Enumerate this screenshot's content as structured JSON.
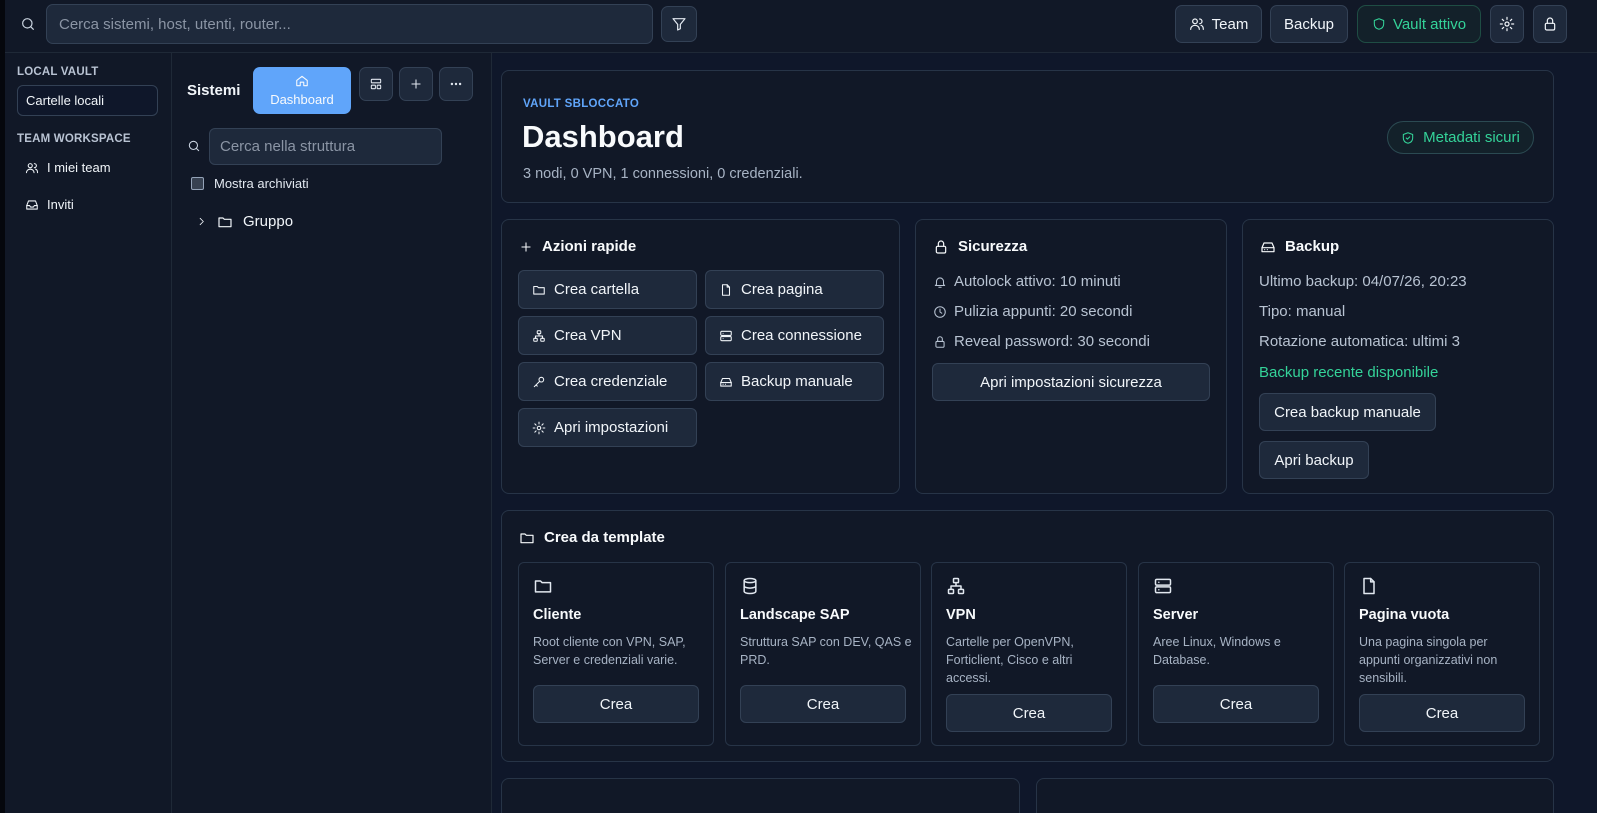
{
  "topbar": {
    "search_placeholder": "Cerca sistemi, host, utenti, router...",
    "team_label": "Team",
    "backup_label": "Backup",
    "vault_status": "Vault attivo"
  },
  "sidebar": {
    "local_heading": "LOCAL VAULT",
    "local_item": "Cartelle locali",
    "team_heading": "TEAM WORKSPACE",
    "items": [
      {
        "label": "I miei team",
        "icon": "users-icon"
      },
      {
        "label": "Inviti",
        "icon": "inbox-icon"
      }
    ]
  },
  "tree": {
    "title": "Sistemi",
    "dashboard_label": "Dashboard",
    "search_placeholder": "Cerca nella struttura",
    "archive_label": "Mostra archiviati",
    "group_label": "Gruppo"
  },
  "hero": {
    "eyebrow": "VAULT SBLOCCATO",
    "title": "Dashboard",
    "subtitle": "3 nodi, 0 VPN, 1 connessioni, 0 credenziali.",
    "badge": "Metadati sicuri"
  },
  "quick_actions": {
    "title": "Azioni rapide",
    "buttons": [
      {
        "label": "Crea cartella",
        "icon": "folder-icon"
      },
      {
        "label": "Crea pagina",
        "icon": "file-icon"
      },
      {
        "label": "Crea VPN",
        "icon": "network-icon"
      },
      {
        "label": "Crea connessione",
        "icon": "server-icon"
      },
      {
        "label": "Crea credenziale",
        "icon": "key-icon"
      },
      {
        "label": "Backup manuale",
        "icon": "drive-icon"
      },
      {
        "label": "Apri impostazioni",
        "icon": "gear-icon"
      }
    ]
  },
  "security": {
    "title": "Sicurezza",
    "lines": [
      {
        "label": "Autolock attivo: 10 minuti",
        "icon": "bell-icon"
      },
      {
        "label": "Pulizia appunti: 20 secondi",
        "icon": "clock-icon"
      },
      {
        "label": "Reveal password: 30 secondi",
        "icon": "lock-icon"
      }
    ],
    "button": "Apri impostazioni sicurezza"
  },
  "backup": {
    "title": "Backup",
    "last": "Ultimo backup: 04/07/26, 20:23",
    "type": "Tipo: manual",
    "rotation": "Rotazione automatica: ultimi 3",
    "status": "Backup recente disponibile",
    "create_btn": "Crea backup manuale",
    "open_btn": "Apri backup"
  },
  "templates": {
    "title": "Crea da template",
    "items": [
      {
        "title": "Cliente",
        "desc": "Root cliente con VPN, SAP, Server e credenziali varie.",
        "button": "Crea",
        "icon": "folder-icon"
      },
      {
        "title": "Landscape SAP",
        "desc": "Struttura SAP con DEV, QAS e PRD.",
        "button": "Crea",
        "icon": "database-icon"
      },
      {
        "title": "VPN",
        "desc": "Cartelle per OpenVPN, Forticlient, Cisco e altri accessi.",
        "button": "Crea",
        "icon": "network-icon"
      },
      {
        "title": "Server",
        "desc": "Aree Linux, Windows e Database.",
        "button": "Crea",
        "icon": "server-icon"
      },
      {
        "title": "Pagina vuota",
        "desc": "Una pagina singola per appunti organizzativi non sensibili.",
        "button": "Crea",
        "icon": "file-icon"
      }
    ]
  },
  "colors": {
    "accent": "#60a5fa",
    "success": "#34d399",
    "background": "#0f172a",
    "panel": "#111827"
  }
}
